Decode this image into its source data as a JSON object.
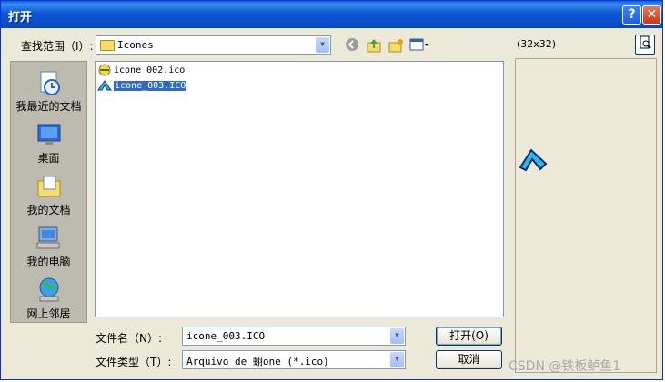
{
  "window": {
    "title": "打开"
  },
  "titlebar": {
    "help_glyph": "?",
    "close_glyph": "✕"
  },
  "lookin": {
    "label": "查找范围（I）:",
    "value": "Icones"
  },
  "preview": {
    "size_label": "(32x32)"
  },
  "places": [
    {
      "label": "我最近的文档",
      "icon": "recent-documents-icon"
    },
    {
      "label": "桌面",
      "icon": "desktop-icon"
    },
    {
      "label": "我的文档",
      "icon": "my-documents-icon"
    },
    {
      "label": "我的电脑",
      "icon": "my-computer-icon"
    },
    {
      "label": "网上邻居",
      "icon": "network-places-icon"
    }
  ],
  "files": [
    {
      "name": "icone_002.ico",
      "selected": false
    },
    {
      "name": "icone_003.ICO",
      "selected": true
    }
  ],
  "filename": {
    "label": "文件名（N）:",
    "value": "icone_003.ICO"
  },
  "filetype": {
    "label": "文件类型（T）:",
    "value": "Arquivo de 蛡one (*.ico)"
  },
  "buttons": {
    "open": "打开(O)",
    "cancel": "取消"
  },
  "watermark": "CSDN @铁板鲈鱼1",
  "colors": {
    "titlebar": "#0b58d4",
    "selection": "#316ac5",
    "dialog_bg": "#ece9d8"
  }
}
